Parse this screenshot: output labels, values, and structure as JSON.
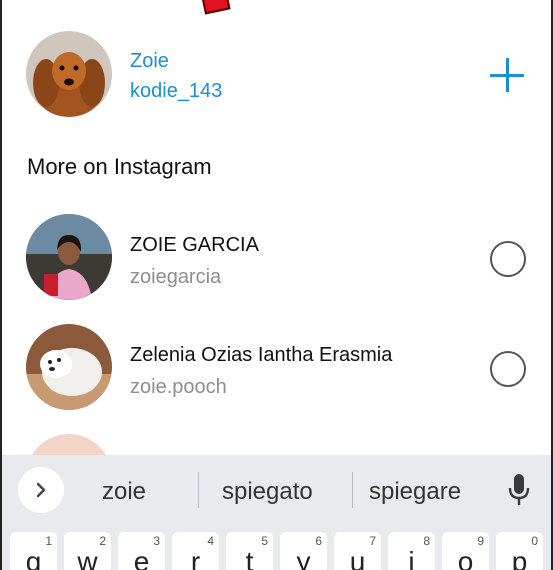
{
  "account": {
    "display_name": "Zoie",
    "username": "kodie_143"
  },
  "section_title": "More on Instagram",
  "suggested_users": [
    {
      "name": "ZOIE GARCIA",
      "username": "zoiegarcia"
    },
    {
      "name": "Zelenia Ozias Iantha Erasmia",
      "username": "zoie.pooch"
    }
  ],
  "keyboard": {
    "suggestions": [
      "zoie",
      "spiegato",
      "spiegare"
    ],
    "keys": [
      {
        "letter": "q",
        "hint": "1"
      },
      {
        "letter": "w",
        "hint": "2"
      },
      {
        "letter": "e",
        "hint": "3"
      },
      {
        "letter": "r",
        "hint": "4"
      },
      {
        "letter": "t",
        "hint": "5"
      },
      {
        "letter": "y",
        "hint": "6"
      },
      {
        "letter": "u",
        "hint": "7"
      },
      {
        "letter": "i",
        "hint": "8"
      },
      {
        "letter": "o",
        "hint": "9"
      },
      {
        "letter": "p",
        "hint": "0"
      }
    ]
  },
  "colors": {
    "accent": "#1a8fd6",
    "secondary_text": "#8e8e8e",
    "keyboard_bg": "#e9eaee"
  },
  "icons": [
    "add-account-icon",
    "radio-unselected-icon",
    "chevron-right-icon",
    "microphone-icon"
  ]
}
